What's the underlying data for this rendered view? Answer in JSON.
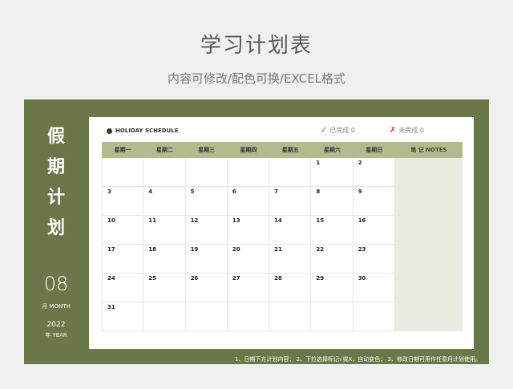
{
  "page": {
    "title": "学习计划表",
    "subtitle": "内容可修改/配色可换/EXCEL格式"
  },
  "sidebar": {
    "chars": [
      "假",
      "期",
      "计",
      "划"
    ],
    "month_num": "08",
    "month_label": "月 MONTH",
    "year_num": "2022",
    "year_label": "年 YEAR"
  },
  "legend": {
    "schedule_label": "HOLIDAY SCHEDULE",
    "done_icon": "✓",
    "done_text": "已完成 0",
    "undone_icon": "✗",
    "undone_text": "未完成 0"
  },
  "calendar": {
    "headers": [
      "星期一",
      "星期二",
      "星期三",
      "星期四",
      "星期五",
      "星期六",
      "星期日"
    ],
    "notes_header": "笔 记 NOTES",
    "weeks": [
      [
        "",
        "",
        "",
        "",
        "",
        "1",
        "2"
      ],
      [
        "3",
        "4",
        "5",
        "6",
        "7",
        "8",
        "9"
      ],
      [
        "10",
        "11",
        "12",
        "13",
        "14",
        "15",
        "16"
      ],
      [
        "17",
        "18",
        "19",
        "20",
        "21",
        "22",
        "23"
      ],
      [
        "24",
        "25",
        "26",
        "27",
        "28",
        "29",
        "30"
      ],
      [
        "31",
        "",
        "",
        "",
        "",
        "",
        ""
      ]
    ]
  },
  "footer": {
    "note": "1、日期下方计划内容；   2、下拉选择标记√或X，自动变色；   3、修改日期可用作任意月计划使用。"
  },
  "colors": {
    "frame": "#6b7748",
    "header": "#b3bb8e",
    "notes": "#e9ebe1",
    "done": "#2e9a3a",
    "undone": "#d9342b"
  }
}
